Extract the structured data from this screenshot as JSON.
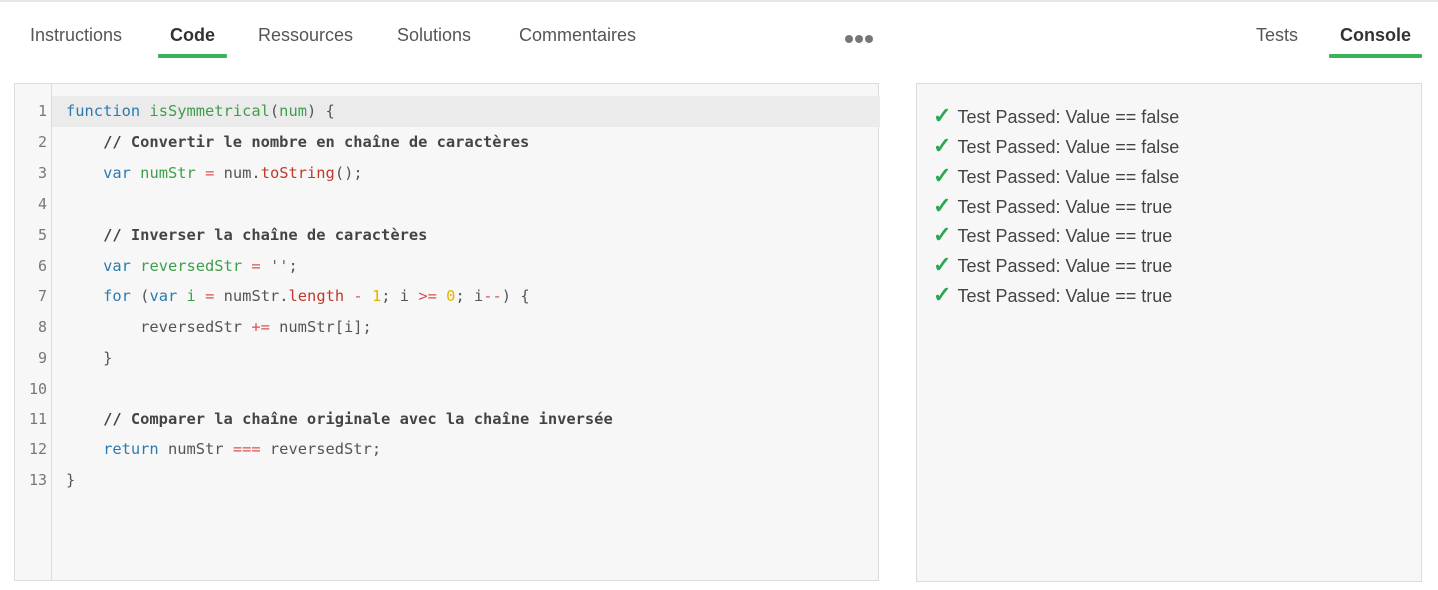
{
  "left_tabs": [
    {
      "label": "Instructions",
      "active": false
    },
    {
      "label": "Code",
      "active": true
    },
    {
      "label": "Ressources",
      "active": false
    },
    {
      "label": "Solutions",
      "active": false
    },
    {
      "label": "Commentaires",
      "active": false
    }
  ],
  "more_icon": "more-dots-icon",
  "right_tabs": [
    {
      "label": "Tests",
      "active": false
    },
    {
      "label": "Console",
      "active": true
    }
  ],
  "editor": {
    "line_numbers": [
      "1",
      "2",
      "3",
      "4",
      "5",
      "6",
      "7",
      "8",
      "9",
      "10",
      "11",
      "12",
      "13"
    ],
    "lines": [
      "function isSymmetrical(num) {",
      "    // Convertir le nombre en chaîne de caractères",
      "    var numStr = num.toString();",
      "",
      "    // Inverser la chaîne de caractères",
      "    var reversedStr = '';",
      "    for (var i = numStr.length - 1; i >= 0; i--) {",
      "        reversedStr += numStr[i];",
      "    }",
      "",
      "    // Comparer la chaîne originale avec la chaîne inversée",
      "    return numStr === reversedStr;",
      "}"
    ]
  },
  "console": {
    "check_icon": "check-icon",
    "check_glyph": "✓",
    "results": [
      "Test Passed: Value == false",
      "Test Passed: Value == false",
      "Test Passed: Value == false",
      "Test Passed: Value == true",
      "Test Passed: Value == true",
      "Test Passed: Value == true",
      "Test Passed: Value == true"
    ]
  },
  "colors": {
    "accent": "#3bb35a",
    "keyword": "#2a7ab0",
    "function": "#3f9e4a",
    "operator": "#d9534f",
    "number": "#e6b400",
    "panel_bg": "#f7f7f7"
  }
}
